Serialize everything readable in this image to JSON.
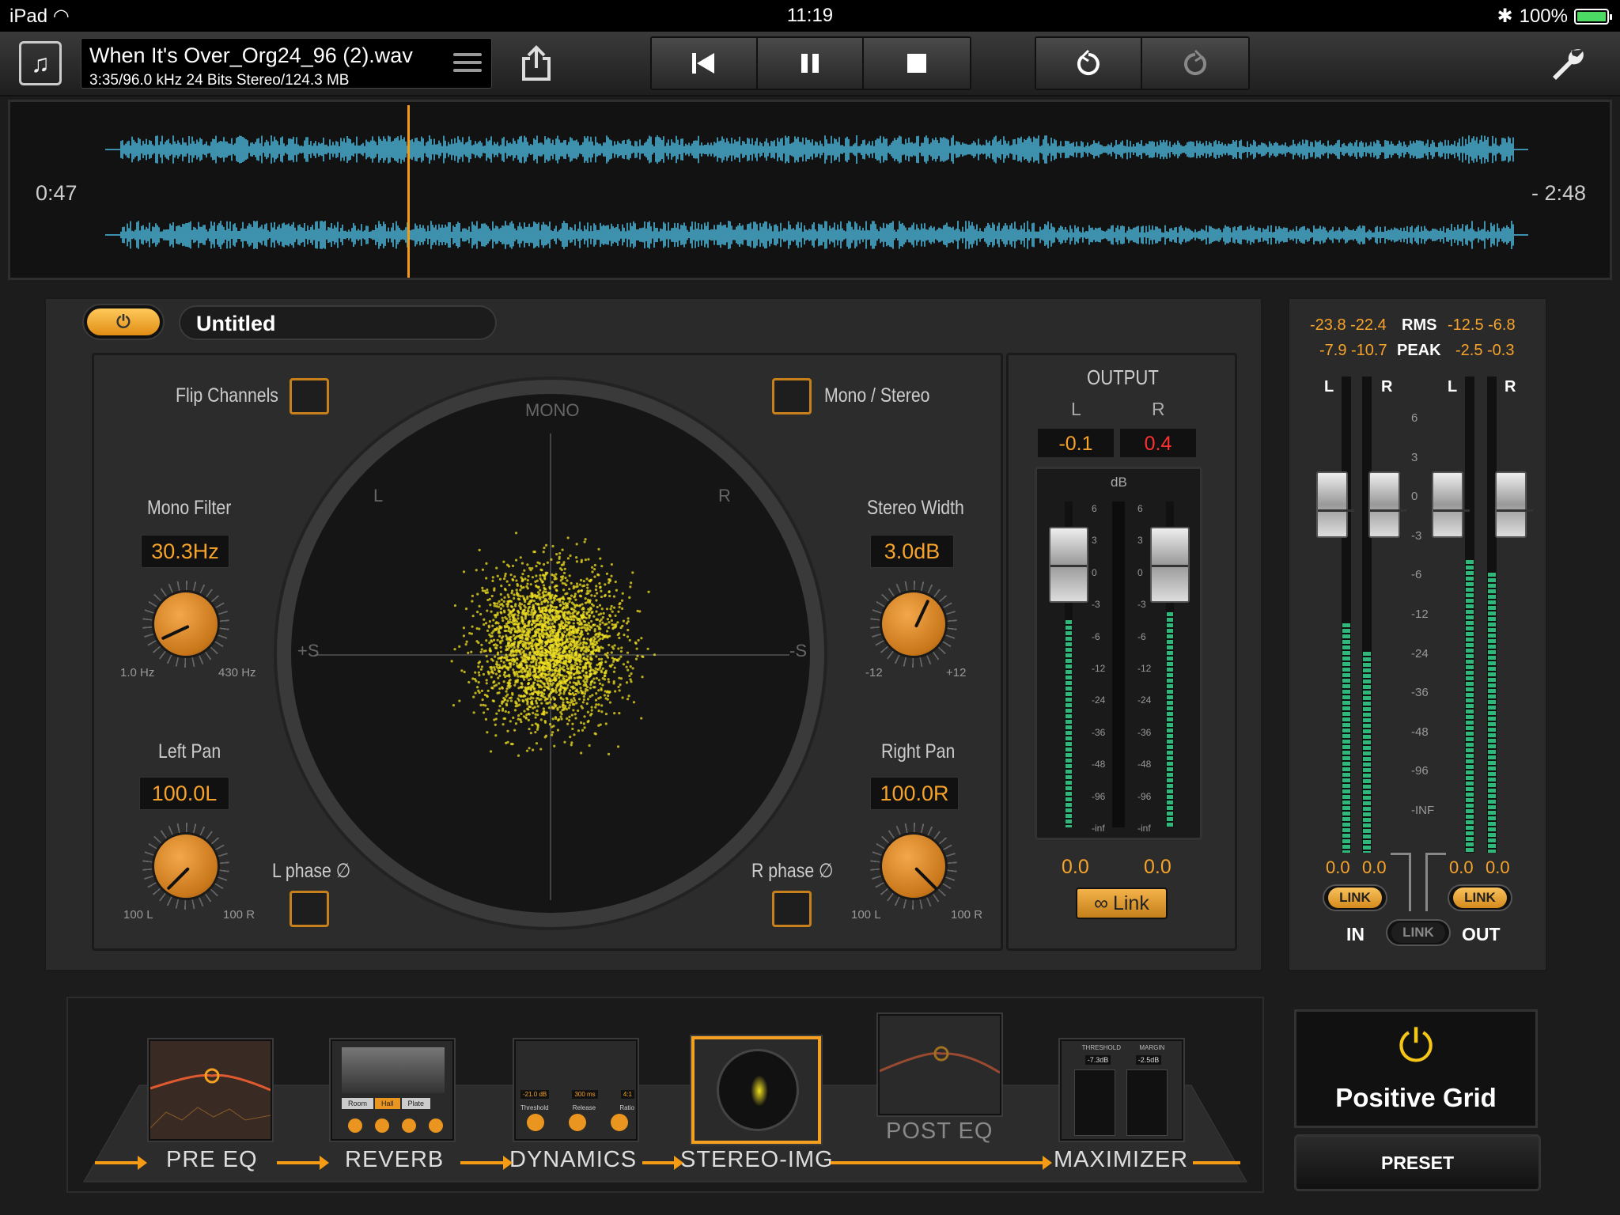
{
  "status_bar": {
    "device": "iPad",
    "time": "11:19",
    "battery": "100%"
  },
  "toolbar": {
    "file_name": "When It's Over_Org24_96 (2).wav",
    "file_info": "3:35/96.0 kHz 24 Bits Stereo/124.3 MB"
  },
  "waveform": {
    "elapsed": "0:47",
    "remaining": "- 2:48",
    "playhead_fraction": 0.22
  },
  "editor": {
    "preset_name": "Untitled",
    "flip_channels_label": "Flip Channels",
    "mono_stereo_label": "Mono / Stereo",
    "mono_filter": {
      "label": "Mono Filter",
      "value": "30.3Hz",
      "min": "1.0 Hz",
      "max": "430 Hz"
    },
    "stereo_width": {
      "label": "Stereo Width",
      "value": "3.0dB",
      "min": "-12",
      "max": "+12"
    },
    "left_pan": {
      "label": "Left Pan",
      "value": "100.0L",
      "min": "100 L",
      "max": "100 R"
    },
    "right_pan": {
      "label": "Right Pan",
      "value": "100.0R",
      "min": "100 L",
      "max": "100 R"
    },
    "l_phase_label": "L phase ∅",
    "r_phase_label": "R phase ∅",
    "scope": {
      "top": "MONO",
      "left": "L",
      "right": "R",
      "side_left": "+S",
      "side_right": "-S"
    }
  },
  "output": {
    "title": "OUTPUT",
    "l": "L",
    "r": "R",
    "l_value": "-0.1",
    "r_value": "0.4",
    "unit": "dB",
    "scale_left": [
      "6",
      "3",
      "0",
      "-3",
      "-6",
      "-12",
      "-24",
      "-36",
      "-48",
      "-96",
      "-inf"
    ],
    "scale_right": [
      "6",
      "3",
      "0",
      "-3",
      "-6",
      "-12",
      "-24",
      "-36",
      "-48",
      "-96",
      "-inf"
    ],
    "l_gain": "0.0",
    "r_gain": "0.0",
    "link_label": "Link"
  },
  "io_meter": {
    "in_rms": "-23.8 -22.4",
    "out_rms": "-12.5 -6.8",
    "rms_label": "RMS",
    "in_peak": "-7.9 -10.7",
    "out_peak": "-2.5 -0.3",
    "peak_label": "PEAK",
    "scale": [
      "6",
      "3",
      "0",
      "-3",
      "-6",
      "-12",
      "-24",
      "-36",
      "-48",
      "-96",
      "-INF"
    ],
    "in_l": "0.0",
    "in_r": "0.0",
    "out_l": "0.0",
    "out_r": "0.0",
    "link": "LINK",
    "in": "IN",
    "out": "OUT",
    "ch_l": "L",
    "ch_r": "R"
  },
  "chain": {
    "modules": [
      {
        "label": "PRE EQ"
      },
      {
        "label": "REVERB",
        "buttons": [
          "Room",
          "Hall",
          "Plate"
        ]
      },
      {
        "label": "DYNAMICS",
        "readouts": [
          "-21.0 dB",
          "300 ms",
          "4:1"
        ],
        "knob_labels": [
          "Threshold",
          "Release",
          "Ratio"
        ]
      },
      {
        "label": "STEREO-IMG"
      },
      {
        "label": "POST EQ"
      },
      {
        "label": "MAXIMIZER",
        "headers": [
          "THRESHOLD",
          "MARGIN"
        ],
        "values": [
          "-7.3dB",
          "-2.5dB"
        ]
      }
    ],
    "brand": "Positive Grid",
    "preset_button": "PRESET"
  },
  "colors": {
    "accent": "#f59b14",
    "waveform": "#52c8f0",
    "scope": "#f0e020",
    "meter": "#2eb87a"
  }
}
